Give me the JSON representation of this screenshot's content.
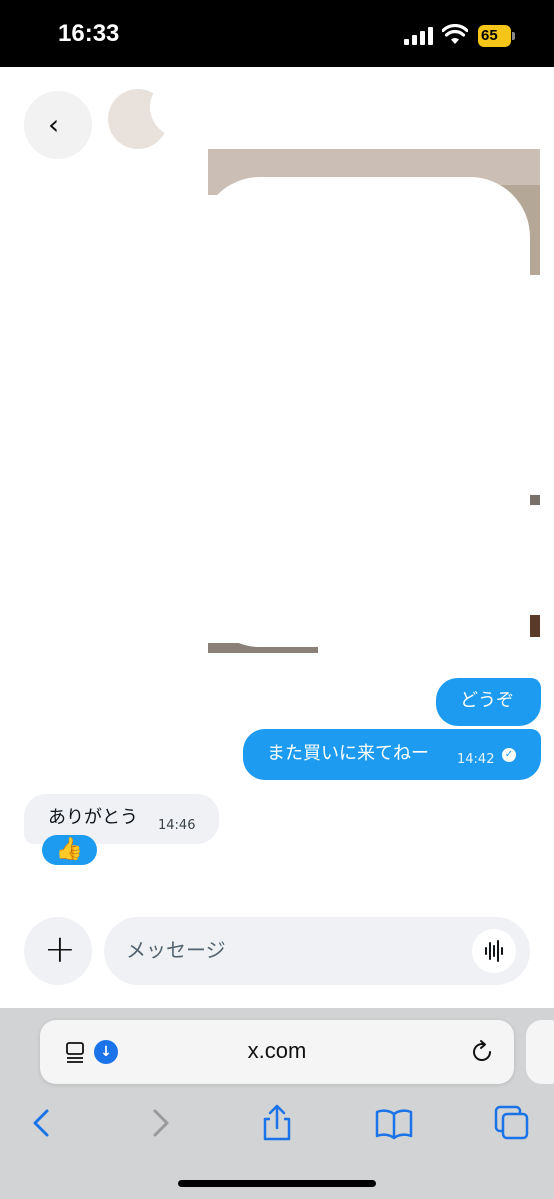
{
  "status_bar": {
    "time": "16:33",
    "battery": "65"
  },
  "chat": {
    "messages": [
      {
        "text": "どうぞ",
        "direction": "outgoing"
      },
      {
        "text": "また買いに来てねー",
        "time": "14:42",
        "direction": "outgoing",
        "status": "read"
      },
      {
        "text": "ありがとう",
        "time": "14:46",
        "direction": "incoming",
        "reaction": "👍"
      }
    ]
  },
  "composer": {
    "placeholder": "メッセージ"
  },
  "browser": {
    "url": "x.com"
  },
  "colors": {
    "accent": "#1d9bf0",
    "incoming_bubble": "#eff1f4",
    "toolbar": "#d2d3d4",
    "ios_blue": "#1a73e8"
  },
  "icons": [
    "back-arrow-icon",
    "plus-icon",
    "voice-wave-icon",
    "reader-icon",
    "download-icon",
    "reload-icon",
    "nav-back-icon",
    "nav-forward-icon",
    "share-icon",
    "bookmarks-icon",
    "tabs-icon"
  ]
}
